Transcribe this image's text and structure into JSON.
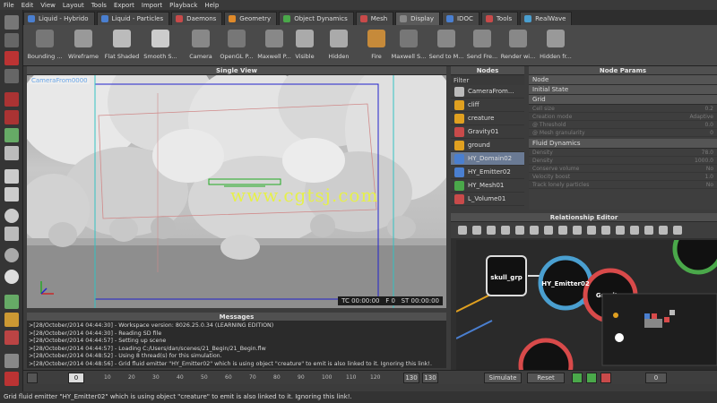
{
  "menu": [
    "File",
    "Edit",
    "View",
    "Layout",
    "Tools",
    "Export",
    "Import",
    "Playback",
    "Help"
  ],
  "tabs": [
    {
      "label": "Liquid - Hybrido",
      "color": "#4a7fd0"
    },
    {
      "label": "Liquid - Particles",
      "color": "#4a7fd0"
    },
    {
      "label": "Daemons",
      "color": "#c84a4a"
    },
    {
      "label": "Geometry",
      "color": "#e08a2a"
    },
    {
      "label": "Object Dynamics",
      "color": "#4aa84a"
    },
    {
      "label": "Mesh",
      "color": "#c84a4a"
    },
    {
      "label": "Display",
      "color": "#888888"
    },
    {
      "label": "IDOC",
      "color": "#4a7fd0"
    },
    {
      "label": "Tools",
      "color": "#c84a4a"
    },
    {
      "label": "RealWave",
      "color": "#4a9fd0"
    }
  ],
  "shelf": [
    "Bounding ...",
    "Wireframe",
    "Flat Shaded",
    "Smooth S...",
    "Camera",
    "OpenGL P...",
    "Maxwell P...",
    "Visible",
    "Hidden",
    "Fire",
    "Maxwell S...",
    "Send to M...",
    "Send Fre...",
    "Render wi...",
    "Hidden fr..."
  ],
  "viewport": {
    "title": "Single View",
    "camera": "CameraFrom0000",
    "timecode": "TC 00:00:00",
    "frame": "F 0",
    "simtime": "ST 00:00:00",
    "watermark": "www.cgtsj.com"
  },
  "nodes": {
    "title": "Nodes",
    "filter": "Filter",
    "items": [
      {
        "label": "CameraFrom...",
        "color": "#bbbbbb"
      },
      {
        "label": "cliff",
        "color": "#e0a020"
      },
      {
        "label": "creature",
        "color": "#e0a020"
      },
      {
        "label": "Gravity01",
        "color": "#c84a4a"
      },
      {
        "label": "ground",
        "color": "#e0a020"
      },
      {
        "label": "HY_Domain02",
        "color": "#4a7fd0"
      },
      {
        "label": "HY_Emitter02",
        "color": "#4a7fd0"
      },
      {
        "label": "HY_Mesh01",
        "color": "#4aa84a"
      },
      {
        "label": "L_Volume01",
        "color": "#c84a4a"
      }
    ]
  },
  "params": {
    "title": "Node Params",
    "sections": [
      "Node",
      "Initial State",
      "Grid"
    ],
    "grid_rows": [
      {
        "k": "Cell size",
        "v": "0.2"
      },
      {
        "k": "Creation mode",
        "v": "Adaptive"
      },
      {
        "k": "@ Threshold",
        "v": "0.0"
      },
      {
        "k": "@ Mesh granularity",
        "v": "0"
      }
    ],
    "fluid_title": "Fluid Dynamics",
    "fluid_rows": [
      {
        "k": "Density",
        "v": "78.0"
      },
      {
        "k": "Density",
        "v": "1000.0"
      },
      {
        "k": "Conserve volume",
        "v": "No"
      },
      {
        "k": "Velocity boost",
        "v": "1.0"
      },
      {
        "k": "Track lonely particles",
        "v": "No"
      }
    ]
  },
  "relationship": {
    "title": "Relationship Editor",
    "nodes": [
      "skull_grp",
      "HY_Emitter02",
      "Gravit..."
    ]
  },
  "messages": {
    "title": "Messages",
    "lines": [
      ">[28/October/2014 04:44:30] - Workspace version: 8026.25.0.34 (LEARNING EDITION)",
      ">[28/October/2014 04:44:30] - Reading SD file",
      ">[28/October/2014 04:44:57] - Setting up scene",
      ">[28/October/2014 04:44:57] - Loading C:/Users/dan/scenes/21_Begin/21_Begin.flw",
      ">[28/October/2014 04:48:52] - Using 8 thread(s) for this simulation.",
      ">[28/October/2014 04:48:56] - Grid fluid emitter \"HY_Emitter02\" which is using object \"creature\" to emit is also linked to it. Ignoring this link!."
    ]
  },
  "timeline": {
    "current_frame": "0",
    "ticks": [
      "10",
      "20",
      "30",
      "40",
      "50",
      "60",
      "70",
      "80",
      "90",
      "100",
      "110",
      "120"
    ],
    "end_a": "130",
    "end_b": "130",
    "simulate": "Simulate",
    "reset": "Reset",
    "frame_field": "0"
  },
  "status": "Grid fluid emitter \"HY_Emitter02\" which is using object \"creature\" to emit is also linked to it. Ignoring this link!."
}
